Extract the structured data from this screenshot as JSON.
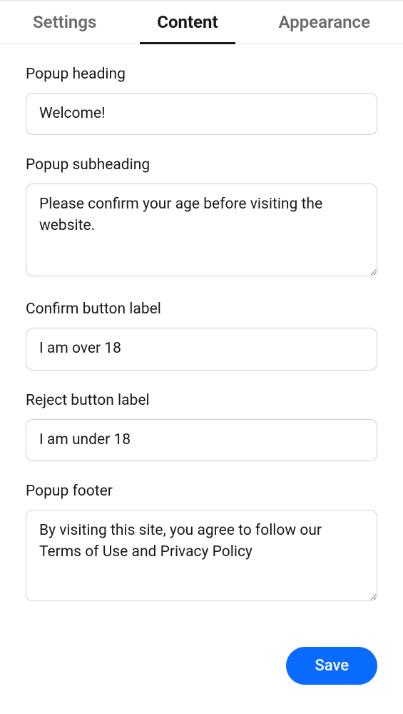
{
  "tabs": {
    "settings": "Settings",
    "content": "Content",
    "appearance": "Appearance"
  },
  "form": {
    "popup_heading": {
      "label": "Popup heading",
      "value": "Welcome!"
    },
    "popup_subheading": {
      "label": "Popup subheading",
      "value": "Please confirm your age before visiting the website."
    },
    "confirm_button": {
      "label": "Confirm button label",
      "value": "I am over 18"
    },
    "reject_button": {
      "label": "Reject button label",
      "value": "I am under 18"
    },
    "popup_footer": {
      "label": "Popup footer",
      "value": "By visiting this site, you agree to follow our Terms of Use and Privacy Policy"
    }
  },
  "actions": {
    "save": "Save"
  }
}
